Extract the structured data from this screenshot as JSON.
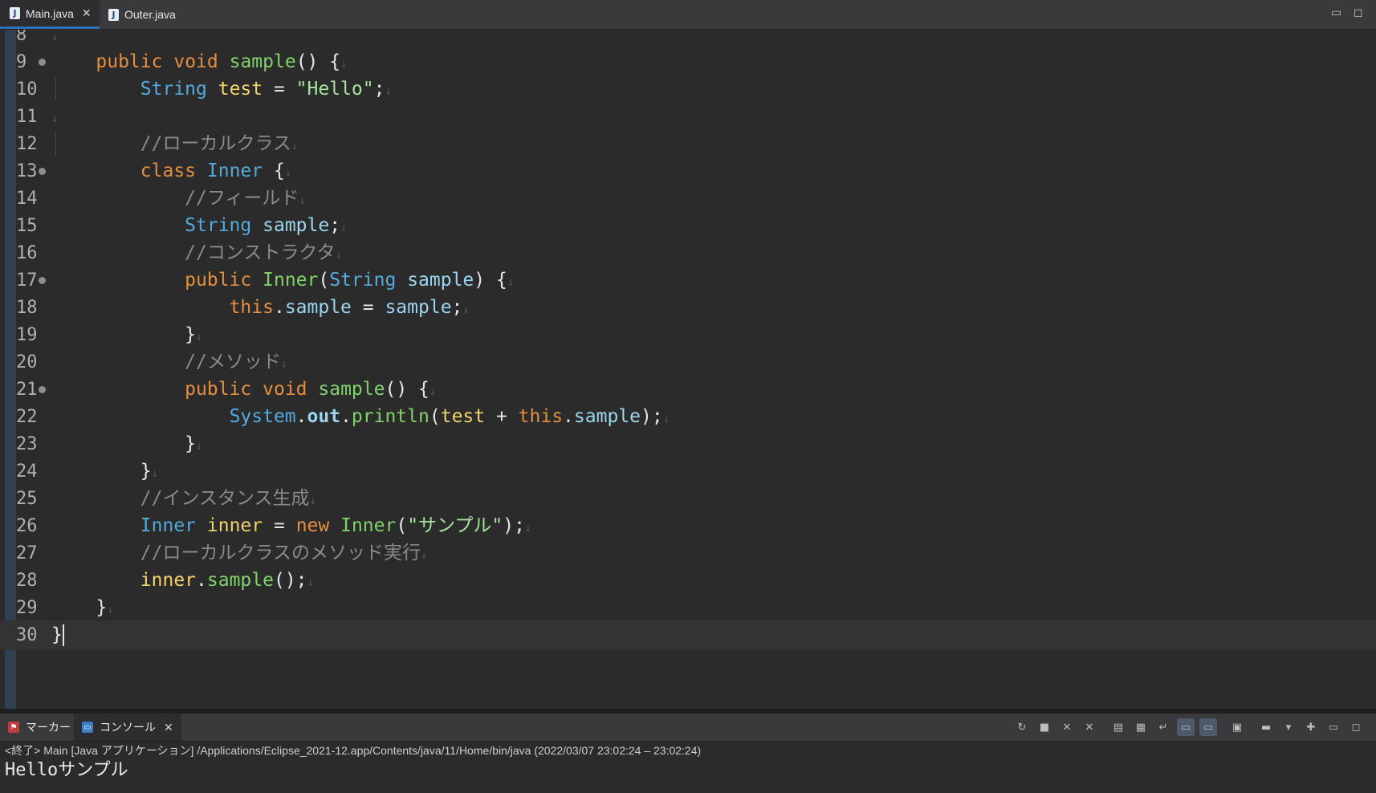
{
  "editor_tabs": [
    {
      "label": "Main.java",
      "icon": "java-file-icon",
      "active": true
    },
    {
      "label": "Outer.java",
      "icon": "java-file-icon",
      "active": false
    }
  ],
  "window_controls": {
    "minimize": "▭",
    "maximize": "◻"
  },
  "code_lines": [
    {
      "n": "8",
      "fold": false,
      "guide": false,
      "html": "<span class='nl'>↓</span>"
    },
    {
      "n": "9",
      "fold": true,
      "guide": false,
      "html": "    <span class='kw'>public</span> <span class='kw'>void</span> <span class='fn'>sample</span>() {<span class='nl'>↓</span>"
    },
    {
      "n": "10",
      "fold": false,
      "guide": true,
      "html": "        <span class='ty'>String</span> <span class='var'>test</span> = <span class='str'>\"Hello\"</span>;<span class='nl'>↓</span>"
    },
    {
      "n": "11",
      "fold": false,
      "guide": false,
      "html": "<span class='nl'>↓</span>"
    },
    {
      "n": "12",
      "fold": false,
      "guide": true,
      "html": "        <span class='cm'>//ローカルクラス</span><span class='nl'>↓</span>"
    },
    {
      "n": "13",
      "fold": true,
      "guide": false,
      "html": "        <span class='kw'>class</span> <span class='ty'>Inner</span> {<span class='nl'>↓</span>"
    },
    {
      "n": "14",
      "fold": false,
      "guide": false,
      "html": "            <span class='cm'>//フィールド</span><span class='nl'>↓</span>"
    },
    {
      "n": "15",
      "fold": false,
      "guide": false,
      "html": "            <span class='ty'>String</span> <span class='fld'>sample</span>;<span class='nl'>↓</span>"
    },
    {
      "n": "16",
      "fold": false,
      "guide": false,
      "html": "            <span class='cm'>//コンストラクタ</span><span class='nl'>↓</span>"
    },
    {
      "n": "17",
      "fold": true,
      "guide": false,
      "html": "            <span class='kw'>public</span> <span class='fn'>Inner</span>(<span class='ty'>String</span> <span class='fld'>sample</span>) {<span class='nl'>↓</span>"
    },
    {
      "n": "18",
      "fold": false,
      "guide": false,
      "html": "                <span class='kw'>this</span>.<span class='fld'>sample</span> = <span class='fld'>sample</span>;<span class='nl'>↓</span>"
    },
    {
      "n": "19",
      "fold": false,
      "guide": false,
      "html": "            }<span class='nl'>↓</span>"
    },
    {
      "n": "20",
      "fold": false,
      "guide": false,
      "html": "            <span class='cm'>//メソッド</span><span class='nl'>↓</span>"
    },
    {
      "n": "21",
      "fold": true,
      "guide": false,
      "html": "            <span class='kw'>public</span> <span class='kw'>void</span> <span class='fn'>sample</span>() {<span class='nl'>↓</span>"
    },
    {
      "n": "22",
      "fold": false,
      "guide": false,
      "html": "                <span class='ty'>System</span>.<span class='fld'><b>out</b></span>.<span class='fn'>println</span>(<span class='var'>test</span> + <span class='kw'>this</span>.<span class='fld'>sample</span>);<span class='nl'>↓</span>"
    },
    {
      "n": "23",
      "fold": false,
      "guide": false,
      "html": "            }<span class='nl'>↓</span>"
    },
    {
      "n": "24",
      "fold": false,
      "guide": false,
      "html": "        }<span class='nl'>↓</span>"
    },
    {
      "n": "25",
      "fold": false,
      "guide": false,
      "html": "        <span class='cm'>//インスタンス生成</span><span class='nl'>↓</span>"
    },
    {
      "n": "26",
      "fold": false,
      "guide": false,
      "html": "        <span class='ty'>Inner</span> <span class='var'>inner</span> = <span class='kw'>new</span> <span class='fn'>Inner</span>(<span class='str'>\"サンプル\"</span>);<span class='nl'>↓</span>"
    },
    {
      "n": "27",
      "fold": false,
      "guide": false,
      "html": "        <span class='cm'>//ローカルクラスのメソッド実行</span><span class='nl'>↓</span>"
    },
    {
      "n": "28",
      "fold": false,
      "guide": false,
      "html": "        <span class='var'>inner</span>.<span class='fn'>sample</span>();<span class='nl'>↓</span>"
    },
    {
      "n": "29",
      "fold": false,
      "guide": false,
      "html": "    }<span class='nl'>↓</span>"
    },
    {
      "n": "30",
      "fold": false,
      "guide": false,
      "current": true,
      "html": "}<span class='caret'></span>"
    }
  ],
  "console": {
    "tabs": [
      {
        "label": "マーカー",
        "icon": "markers-icon",
        "active": false
      },
      {
        "label": "コンソール",
        "icon": "console-icon",
        "active": true
      }
    ],
    "path": "<終了> Main [Java アプリケーション] /Applications/Eclipse_2021-12.app/Contents/java/11/Home/bin/java  (2022/03/07 23:02:24 – 23:02:24)",
    "output": "Helloサンプル",
    "toolbar": [
      {
        "name": "relaunch-icon",
        "glyph": "↻"
      },
      {
        "name": "terminate-icon",
        "glyph": "■"
      },
      {
        "name": "remove-launch-icon",
        "glyph": "✕"
      },
      {
        "name": "remove-all-terminated-icon",
        "glyph": "✕"
      },
      {
        "name": "clear-console-icon",
        "glyph": "▤"
      },
      {
        "name": "scroll-lock-icon",
        "glyph": "▦"
      },
      {
        "name": "word-wrap-icon",
        "glyph": "↵"
      },
      {
        "name": "show-on-stdout-icon",
        "glyph": "▭",
        "on": true
      },
      {
        "name": "show-on-stderr-icon",
        "glyph": "▭",
        "on": true
      },
      {
        "name": "pin-console-icon",
        "glyph": "▣"
      },
      {
        "name": "display-selected-console-icon",
        "glyph": "▬"
      },
      {
        "name": "open-console-icon",
        "glyph": "▾"
      },
      {
        "name": "new-console-icon",
        "glyph": "✚"
      }
    ]
  }
}
